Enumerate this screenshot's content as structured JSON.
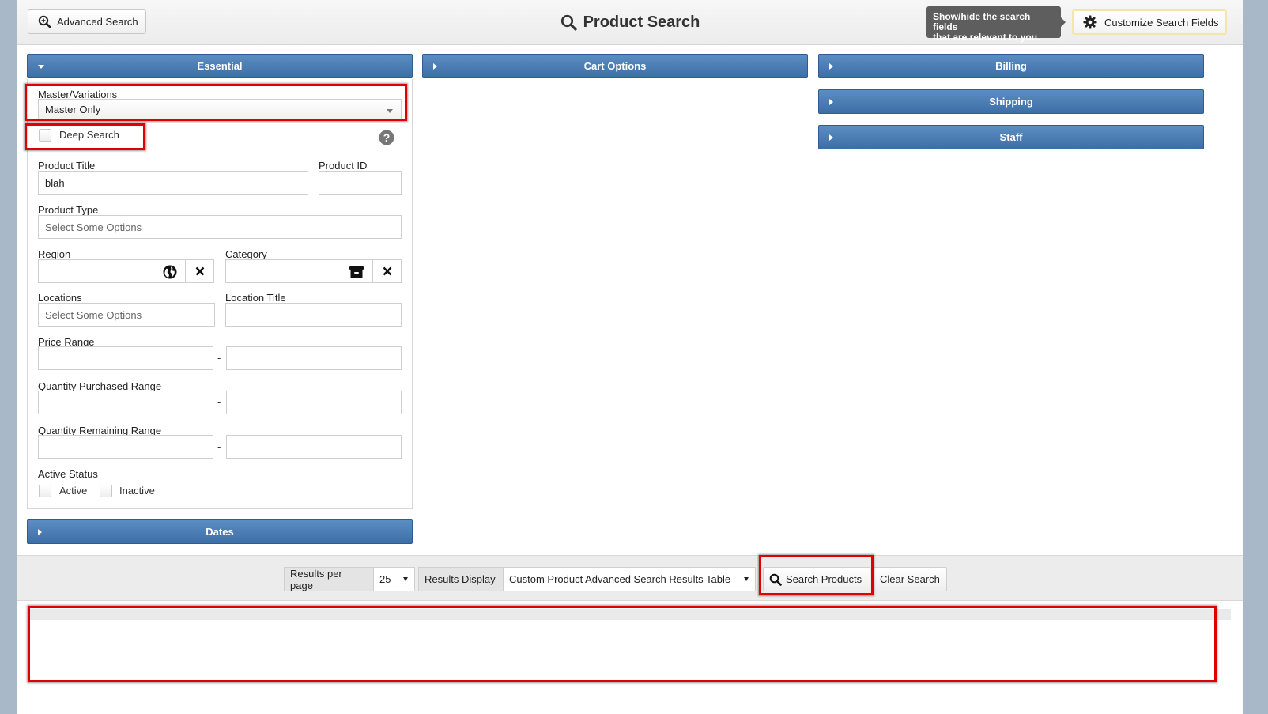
{
  "header": {
    "advanced_search_label": "Advanced Search",
    "title": "Product Search",
    "tooltip_line1": "Show/hide the search fields",
    "tooltip_line2": "that are relevant to you.",
    "customize_label": "Customize Search Fields"
  },
  "sections": {
    "essential": "Essential",
    "cart_options": "Cart Options",
    "billing": "Billing",
    "shipping": "Shipping",
    "staff": "Staff",
    "dates": "Dates"
  },
  "form": {
    "master_variations_label": "Master/Variations",
    "master_variations_value": "Master Only",
    "deep_search_label": "Deep Search",
    "product_title_label": "Product Title",
    "product_title_value": "blah",
    "product_id_label": "Product ID",
    "product_type_label": "Product Type",
    "product_type_placeholder": "Select Some Options",
    "region_label": "Region",
    "category_label": "Category",
    "locations_label": "Locations",
    "locations_placeholder": "Select Some Options",
    "location_title_label": "Location Title",
    "price_range_label": "Price Range",
    "qty_purchased_label": "Quantity Purchased Range",
    "qty_remaining_label": "Quantity Remaining Range",
    "range_separator": "-",
    "active_status_label": "Active Status",
    "active_label": "Active",
    "inactive_label": "Inactive"
  },
  "toolbar": {
    "results_per_page_label": "Results per page",
    "results_per_page_value": "25",
    "results_display_label": "Results Display",
    "results_display_value": "Custom Product Advanced Search Results Table",
    "search_button": "Search Products",
    "clear_button": "Clear Search"
  },
  "colors": {
    "section_bar": "#4a7db5",
    "highlight": "#e00000"
  }
}
